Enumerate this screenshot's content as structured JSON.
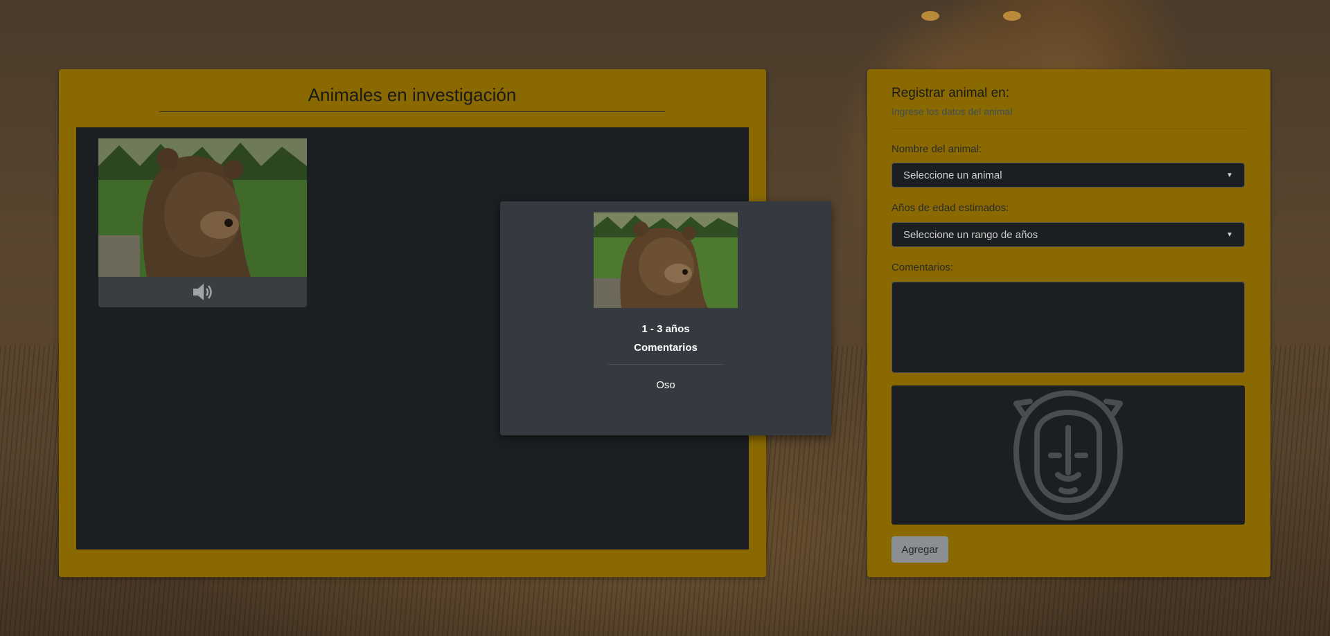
{
  "investigation": {
    "title": "Animales en investigación"
  },
  "modal": {
    "age": "1 - 3 años",
    "comments_heading": "Comentarios",
    "animal_name": "Oso"
  },
  "form": {
    "title": "Registrar animal en:",
    "subtitle": "Ingrese los datos del animal",
    "animal_label": "Nombre del animal:",
    "animal_select_value": "Seleccione un animal",
    "age_label": "Años de edad estimados:",
    "age_select_value": "Seleccione un rango de años",
    "comments_label": "Comentarios:",
    "comments_value": "",
    "add_button": "Agregar"
  },
  "colors": {
    "panel": "#8a6a00",
    "stage": "#1c1f22",
    "modal": "#343a40"
  },
  "icons": {
    "sound": "speaker-icon",
    "preview": "lion-outline-icon"
  }
}
